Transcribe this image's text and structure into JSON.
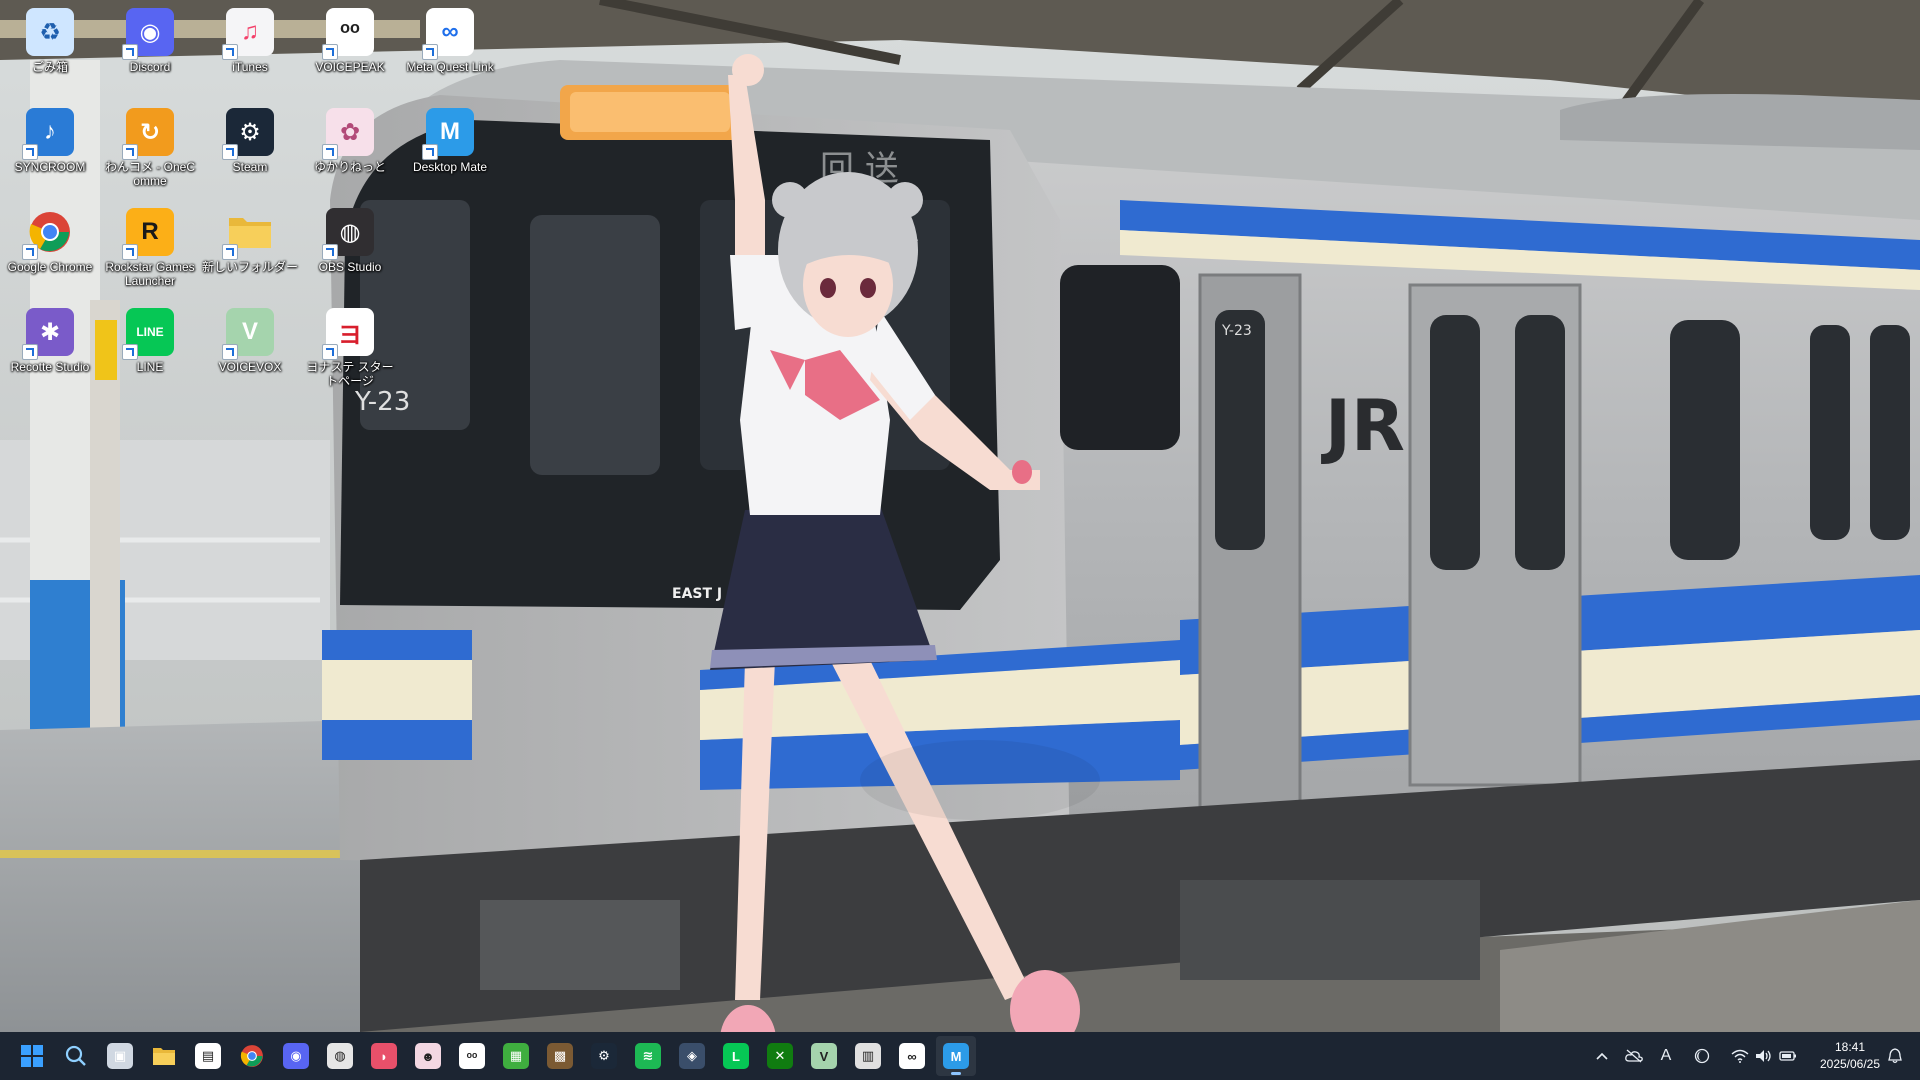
{
  "desktop": {
    "icons": [
      {
        "label": "ごみ箱",
        "icon": "recycle-bin-icon",
        "color": "#cfe6ff"
      },
      {
        "label": "Discord",
        "icon": "discord-icon",
        "color": "#5865f2"
      },
      {
        "label": "iTunes",
        "icon": "itunes-icon",
        "color": "#f5f5f7"
      },
      {
        "label": "VOICEPEAK",
        "icon": "voicepeak-icon",
        "color": "#ffffff"
      },
      {
        "label": "Meta Quest Link",
        "icon": "meta-icon",
        "color": "#ffffff"
      },
      {
        "label": "SYNCROOM",
        "icon": "syncroom-icon",
        "color": "#2a7bd6"
      },
      {
        "label": "わんコメ - OneComme",
        "icon": "onecomme-icon",
        "color": "#f29b1d"
      },
      {
        "label": "Steam",
        "icon": "steam-icon",
        "color": "#1b2838"
      },
      {
        "label": "ゆかりねっと",
        "icon": "yukarinet-icon",
        "color": "#f7e0ea"
      },
      {
        "label": "Desktop Mate",
        "icon": "desktop-mate-icon",
        "color": "#2c9be8"
      },
      {
        "label": "Google Chrome",
        "icon": "chrome-icon",
        "color": "#ffffff"
      },
      {
        "label": "Rockstar Games Launcher",
        "icon": "rockstar-icon",
        "color": "#fcaf17"
      },
      {
        "label": "新しいフォルダー",
        "icon": "folder-icon",
        "color": "#f7c948"
      },
      {
        "label": "OBS Studio",
        "icon": "obs-icon",
        "color": "#302e31"
      },
      {
        "label": "Recotte Studio",
        "icon": "recotte-icon",
        "color": "#7a5bc9"
      },
      {
        "label": "LINE",
        "icon": "line-icon",
        "color": "#06c755"
      },
      {
        "label": "VOICEVOX",
        "icon": "voicevox-icon",
        "color": "#a5d4ad"
      },
      {
        "label": "ヨナステ スタートページ",
        "icon": "yonaste-icon",
        "color": "#ffffff"
      }
    ]
  },
  "wallpaper": {
    "train_destination": "回 送",
    "train_number": "Y-23",
    "car_logo": "JR",
    "front_badge": "EAST J"
  },
  "taskbar": {
    "apps": [
      {
        "name": "start",
        "icon": "windows-start-icon",
        "color": "#3aa0ff"
      },
      {
        "name": "search",
        "icon": "search-icon",
        "color": "#8fd0ff"
      },
      {
        "name": "task-view",
        "icon": "task-view-icon",
        "color": "#d0d8e2"
      },
      {
        "name": "file-explorer",
        "icon": "folder-icon",
        "color": "#f7c948"
      },
      {
        "name": "microsoft-store",
        "icon": "store-icon",
        "color": "#ffffff"
      },
      {
        "name": "chrome",
        "icon": "chrome-icon",
        "color": "#ffffff"
      },
      {
        "name": "discord",
        "icon": "discord-icon",
        "color": "#5865f2"
      },
      {
        "name": "obs",
        "icon": "obs-icon",
        "color": "#e6e6e6"
      },
      {
        "name": "lips-app",
        "icon": "lips-icon",
        "color": "#e8506a"
      },
      {
        "name": "character-app",
        "icon": "character-icon",
        "color": "#f3d7e2"
      },
      {
        "name": "voicepeak",
        "icon": "voicepeak-icon",
        "color": "#ffffff"
      },
      {
        "name": "minecraft",
        "icon": "creeper-icon",
        "color": "#3fae3f"
      },
      {
        "name": "minecraft-launcher",
        "icon": "grass-block-icon",
        "color": "#7b5a33"
      },
      {
        "name": "steam",
        "icon": "steam-icon",
        "color": "#1b2838"
      },
      {
        "name": "spotify",
        "icon": "spotify-icon",
        "color": "#1db954"
      },
      {
        "name": "generic-app",
        "icon": "app-icon",
        "color": "#3a4e6a"
      },
      {
        "name": "line",
        "icon": "line-icon",
        "color": "#06c755"
      },
      {
        "name": "xbox",
        "icon": "xbox-icon",
        "color": "#107c10"
      },
      {
        "name": "voicevox",
        "icon": "voicevox-icon",
        "color": "#a5d4ad"
      },
      {
        "name": "video-editor",
        "icon": "film-icon",
        "color": "#e0e0e0"
      },
      {
        "name": "meta-quest-link",
        "icon": "meta-icon",
        "color": "#ffffff"
      },
      {
        "name": "desktop-mate",
        "icon": "desktop-mate-icon",
        "color": "#2c9be8"
      }
    ],
    "tray": {
      "ime_mode": "A",
      "time": "18:41",
      "date": "2025/06/25"
    }
  }
}
